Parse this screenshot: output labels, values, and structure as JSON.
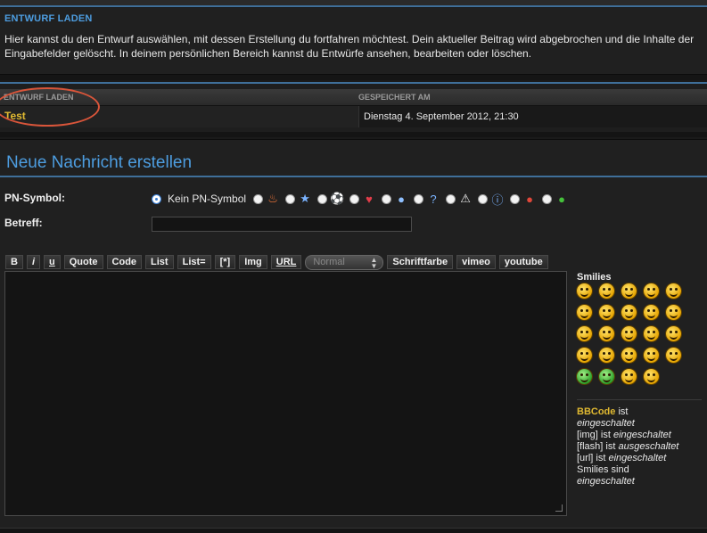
{
  "draft": {
    "heading": "ENTWURF LADEN",
    "description": "Hier kannst du den Entwurf auswählen, mit dessen Erstellung du fortfahren möchtest. Dein aktueller Beitrag wird abgebrochen und die Inhalte der Eingabefelder gelöscht. In deinem persönlichen Bereich kannst du Entwürfe ansehen, bearbeiten oder löschen.",
    "table": {
      "col_name": "ENTWURF LADEN",
      "col_saved": "GESPEICHERT AM",
      "rows": [
        {
          "name": "Test",
          "saved": "Dienstag 4. September 2012, 21:30"
        }
      ]
    }
  },
  "compose": {
    "title": "Neue Nachricht erstellen",
    "pn_label": "PN-Symbol:",
    "pn_none": "Kein PN-Symbol",
    "pn_icons": [
      "fire-icon",
      "star-icon",
      "soccer-ball-icon",
      "heart-icon",
      "speech-bubble-icon",
      "question-icon",
      "warning-icon",
      "info-icon",
      "angry-face-icon",
      "green-face-icon"
    ],
    "subject_label": "Betreff:",
    "subject_value": ""
  },
  "toolbar": {
    "buttons": [
      "B",
      "i",
      "u",
      "Quote",
      "Code",
      "List",
      "List=",
      "[*]",
      "Img",
      "URL"
    ],
    "size_select": "Normal",
    "buttons_after": [
      "Schriftfarbe",
      "vimeo",
      "youtube"
    ]
  },
  "smilies": {
    "title": "Smilies",
    "count": 24
  },
  "bbinfo": {
    "bbcode": "BBCode",
    "is": "ist",
    "enabled": "eingeschaltet",
    "disabled": "ausgeschaltet",
    "img": "[img]",
    "flash": "[flash]",
    "url": "[url]",
    "smilies": "Smilies",
    "sind": "sind"
  },
  "colors": {
    "accent": "#4d9de0",
    "highlight": "#e0b931",
    "annotation": "#d9553a"
  }
}
